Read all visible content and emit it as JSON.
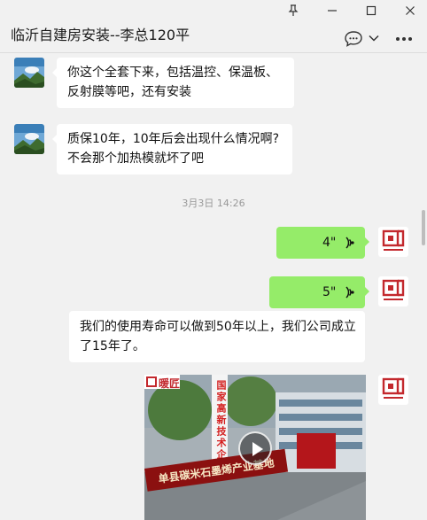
{
  "window": {
    "title": "临沂自建房安装--李总120平",
    "controls": [
      "pin-icon",
      "minimize-icon",
      "maximize-icon",
      "close-icon"
    ]
  },
  "toolbar": {
    "chat_icon": "chat-bubble-icon",
    "dropdown_icon": "chevron-down-icon",
    "more_icon": "more-icon"
  },
  "messages": {
    "m1": {
      "sender": "other",
      "lines": [
        "你这个全套下来，包括温控、保温板、",
        "反射膜等吧，还有安装"
      ]
    },
    "m2": {
      "sender": "other",
      "lines": [
        "质保10年，10年后会出现什么情况啊?",
        "不会那个加热模就坏了吧"
      ]
    },
    "timestamp": "3月3日 14:26",
    "v1": {
      "sender": "self",
      "type": "voice",
      "duration": "4\""
    },
    "v2": {
      "sender": "self",
      "type": "voice",
      "duration": "5\""
    },
    "m3": {
      "sender": "self",
      "lines": [
        "我们的使用寿命可以做到50年以上，我们公司成立",
        "了15年了。"
      ]
    },
    "video": {
      "type": "video",
      "vertical_text": "国家高新技术企业",
      "banner_text": "单县碳米石墨烯产业基地",
      "logo_text": "暖匠"
    }
  },
  "self_avatar": {
    "logo_text": "暖匠"
  },
  "colors": {
    "window_bg": "#f1f1f1",
    "incoming_bubble": "#ffffff",
    "outgoing_bubble": "#95ec69",
    "timestamp": "#999999",
    "brand_red": "#c3282d"
  }
}
